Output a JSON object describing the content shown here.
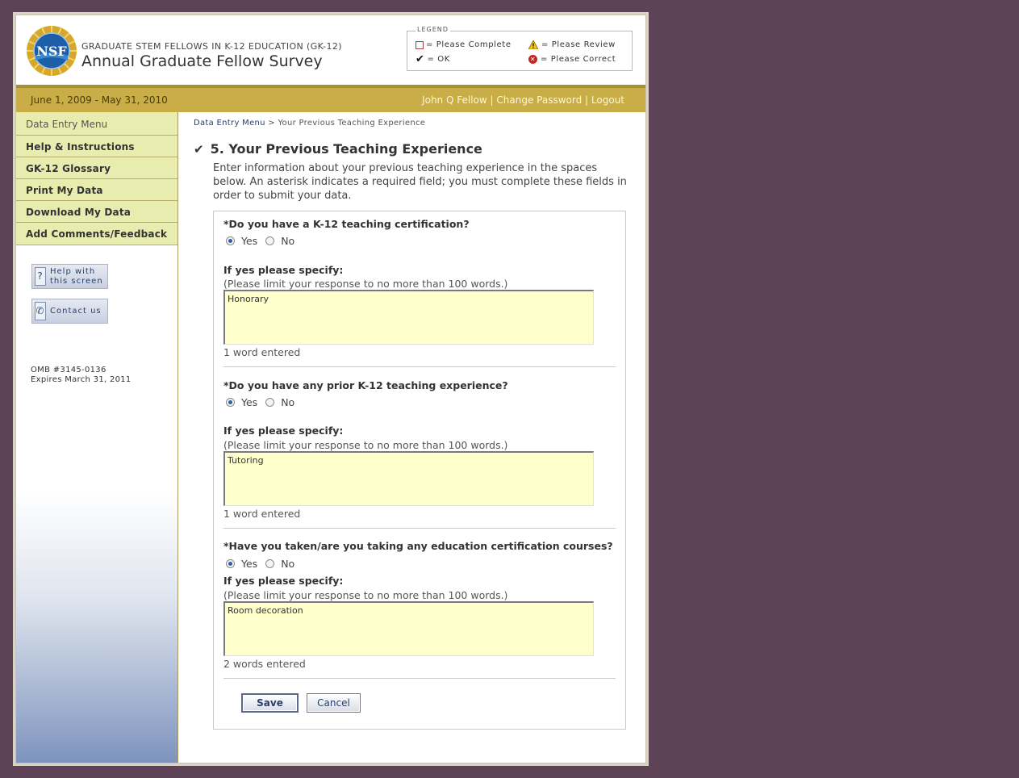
{
  "header": {
    "pre_title": "GRADUATE STEM FELLOWS IN K-12 EDUCATION (GK-12)",
    "title": "Annual Graduate Fellow Survey",
    "logo_text": "NSF"
  },
  "legend": {
    "title": "LEGEND",
    "please_complete": "= Please Complete",
    "please_review": "= Please Review",
    "ok": "= OK",
    "please_correct": "= Please Correct"
  },
  "bar": {
    "period": "June 1, 2009 - May 31, 2010",
    "user": "John Q Fellow",
    "sep": "|",
    "change_password": "Change Password",
    "logout": "Logout"
  },
  "sidebar": {
    "menu_head": "Data Entry Menu",
    "items": [
      {
        "label": "Help & Instructions"
      },
      {
        "label": "GK-12 Glossary"
      },
      {
        "label": "Print My Data"
      },
      {
        "label": "Download My Data"
      },
      {
        "label": "Add Comments/Feedback"
      }
    ],
    "help_line1": "Help with",
    "help_line2": "this screen",
    "contact": "Contact us",
    "omb": "OMB #3145-0136",
    "expires": "Expires March 31, 2011"
  },
  "breadcrumb": {
    "root": "Data Entry Menu",
    "sep": ">",
    "current": "Your Previous Teaching Experience"
  },
  "section": {
    "check": "✔",
    "title": "5. Your Previous Teaching Experience",
    "intro": "Enter information about your previous teaching experience in the spaces below. An asterisk indicates a required field; you must complete these fields in order to submit your data."
  },
  "questions": [
    {
      "label": "*Do you have a K-12 teaching certification?",
      "yes": "Yes",
      "no": "No",
      "selected": "Yes",
      "specify": "If yes please specify:",
      "limit": "(Please limit your response to no more than 100 words.)",
      "answer": "Honorary",
      "count": "1 word entered"
    },
    {
      "label": "*Do you have any prior K-12 teaching experience?",
      "yes": "Yes",
      "no": "No",
      "selected": "Yes",
      "specify": "If yes please specify:",
      "limit": "(Please limit your response to no more than 100 words.)",
      "answer": "Tutoring",
      "count": "1 word entered"
    },
    {
      "label": "*Have you taken/are you taking any education certification courses?",
      "yes": "Yes",
      "no": "No",
      "selected": "Yes",
      "specify": "If yes please specify:",
      "limit": "(Please limit your response to no more than 100 words.)",
      "answer": "Room decoration",
      "count": "2 words entered"
    }
  ],
  "buttons": {
    "save": "Save",
    "cancel": "Cancel"
  }
}
